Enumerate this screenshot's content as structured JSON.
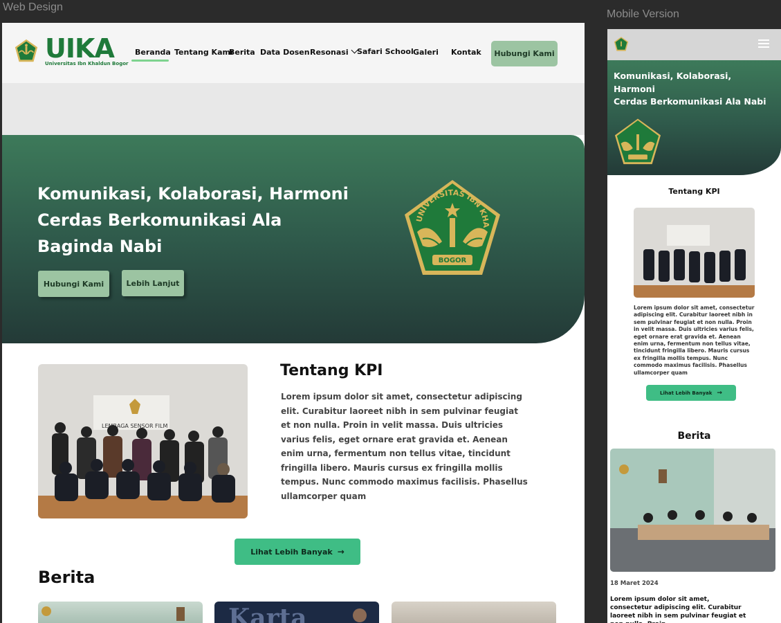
{
  "canvas": {
    "desktop_label": "Web Design",
    "mobile_label": "Mobile Version"
  },
  "colors": {
    "brand_green": "#1f7a3a",
    "hero_top": "#3d7a5a",
    "hero_bottom": "#233a37",
    "button_soft": "#9cc4a2",
    "button_primary": "#3fbd85",
    "gold": "#d8b65a"
  },
  "nav": {
    "logo_word": "UIKA",
    "logo_sub": "Universitas Ibn Khaldun Bogor",
    "items": [
      {
        "label": "Beranda",
        "active": true
      },
      {
        "label": "Tentang Kami",
        "active": false
      },
      {
        "label": "Berita",
        "active": false
      },
      {
        "label": "Data Dosen",
        "active": false
      },
      {
        "label": "Resonasi",
        "active": false,
        "has_dropdown": true
      },
      {
        "label": "Safari School",
        "active": false
      },
      {
        "label": "Galeri",
        "active": false
      },
      {
        "label": "Kontak",
        "active": false
      }
    ],
    "cta": "Hubungi Kami"
  },
  "hero": {
    "title": "Komunikasi, Kolaborasi, Harmoni Cerdas Berkomunikasi Ala Baginda Nabi",
    "btn_contact": "Hubungi Kami",
    "btn_more": "Lebih Lanjut",
    "emblem_text": "UNIVERSITAS IBN KHALDUN",
    "emblem_city": "BOGOR"
  },
  "about": {
    "title": "Tentang KPI",
    "photo_sign": "LEMBAGA SENSOR FILM",
    "text": "Lorem ipsum dolor sit amet, consectetur adipiscing elit. Curabitur laoreet nibh in sem pulvinar feugiat et non nulla. Proin in velit massa. Duis ultricies varius felis, eget ornare erat gravida et. Aenean enim urna, fermentum non tellus vitae, tincidunt fringilla libero. Mauris cursus ex fringilla mollis tempus. Nunc commodo maximus facilisis. Phasellus ullamcorper quam",
    "more_button": "Lihat Lebih Banyak"
  },
  "news": {
    "title": "Berita",
    "card_banner": "Karta"
  },
  "mobile": {
    "hero_title_line1": "Komunikasi, Kolaborasi,",
    "hero_title_line2": "Harmoni",
    "hero_title_line3": "Cerdas Berkomunikasi Ala Nabi",
    "about_title": "Tentang KPI",
    "about_text": "Lorem ipsum dolor sit amet, consectetur adipiscing elit. Curabitur laoreet nibh in sem pulvinar feugiat et non nulla. Proin in velit massa. Duis ultricies varius felis, eget ornare erat gravida et. Aenean enim urna, fermentum non tellus vitae, tincidunt fringilla libero. Mauris cursus ex fringilla mollis tempus. Nunc commodo maximus facilisis. Phasellus ullamcorper quam",
    "more_button": "Lihat Lebih Banyak",
    "news_title": "Berita",
    "news_date": "18 Maret 2024",
    "news_text": "Lorem ipsum dolor sit amet, consectetur adipiscing elit. Curabitur laoreet nibh in sem pulvinar feugiat et non nulla. Proin"
  }
}
